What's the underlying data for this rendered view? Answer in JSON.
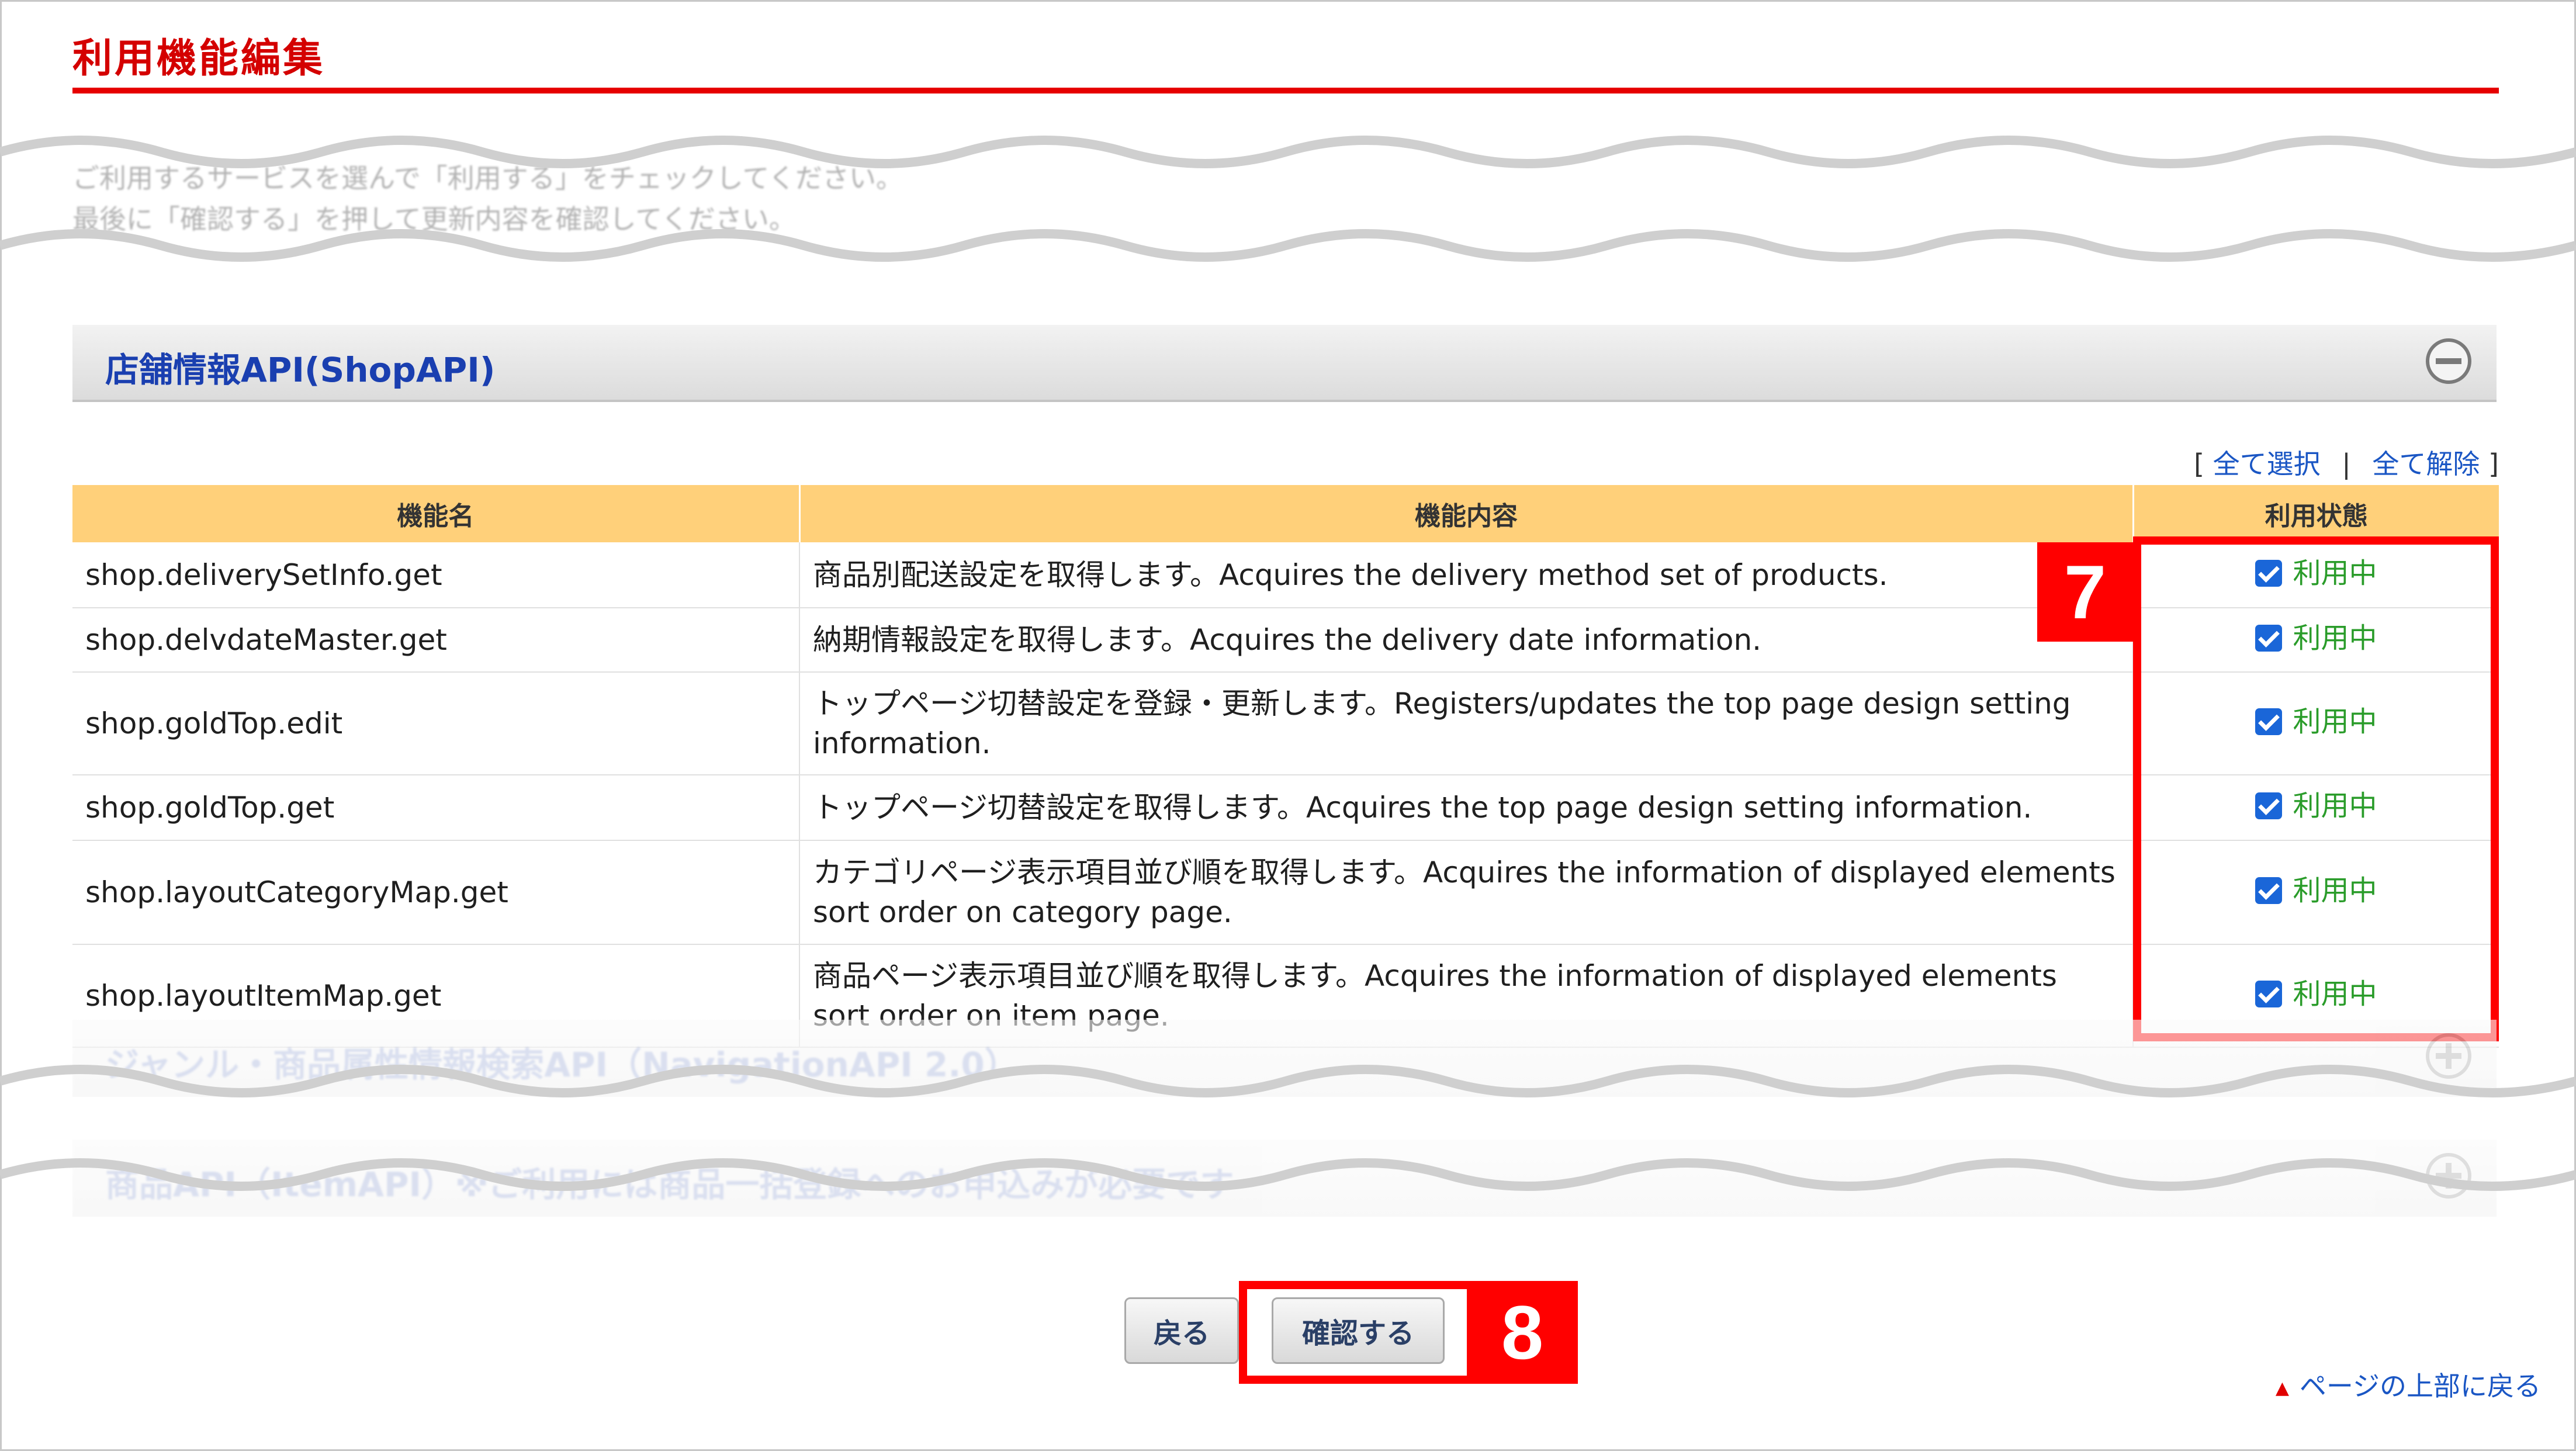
{
  "page": {
    "title": "利用機能編集",
    "intro_line1": "ご利用するサービスを選んで「利用する」をチェックしてください。",
    "intro_line2": "最後に「確認する」を押して更新内容を確認してください。"
  },
  "section": {
    "title": "店舗情報API(ShopAPI)",
    "collapse_icon": "minus-circle-icon"
  },
  "select_links": {
    "open_bracket": "[",
    "select_all": "全て選択",
    "separator": "|",
    "deselect_all": "全て解除",
    "close_bracket": "]"
  },
  "table": {
    "headers": [
      "機能名",
      "機能内容",
      "利用状態"
    ],
    "rows": [
      {
        "name": "shop.deliverySetInfo.get",
        "desc": "商品別配送設定を取得します。Acquires the delivery method set of products.",
        "status": "利用中",
        "checked": true
      },
      {
        "name": "shop.delvdateMaster.get",
        "desc": "納期情報設定を取得します。Acquires the delivery date information.",
        "status": "利用中",
        "checked": true
      },
      {
        "name": "shop.goldTop.edit",
        "desc": "トップページ切替設定を登録・更新します。Registers/updates the top page design setting information.",
        "status": "利用中",
        "checked": true
      },
      {
        "name": "shop.goldTop.get",
        "desc": "トップページ切替設定を取得します。Acquires the top page design setting information.",
        "status": "利用中",
        "checked": true
      },
      {
        "name": "shop.layoutCategoryMap.get",
        "desc": "カテゴリページ表示項目並び順を取得します。Acquires the information of displayed elements sort order on category page.",
        "status": "利用中",
        "checked": true
      },
      {
        "name": "shop.layoutItemMap.get",
        "desc": "商品ページ表示項目並び順を取得します。Acquires the information of displayed elements sort order on item page.",
        "status": "利用中",
        "checked": true
      }
    ]
  },
  "collapsed_sections": [
    {
      "title": "ジャンル・商品属性情報検索API（NavigationAPI 2.0）"
    },
    {
      "title": "商品API（ItemAPI）※ご利用には商品一括登録へのお申込みが必要です"
    }
  ],
  "annotations": {
    "badge_7": "7",
    "badge_8": "8"
  },
  "buttons": {
    "back": "戻る",
    "confirm": "確認する"
  },
  "footer": {
    "page_top": "ページの上部に戻る"
  },
  "colors": {
    "title_red": "#d40000",
    "header_orange": "#ffd07a",
    "link_blue": "#1a56c4",
    "status_green": "#2a9c2a",
    "highlight_red": "#ff0000"
  }
}
